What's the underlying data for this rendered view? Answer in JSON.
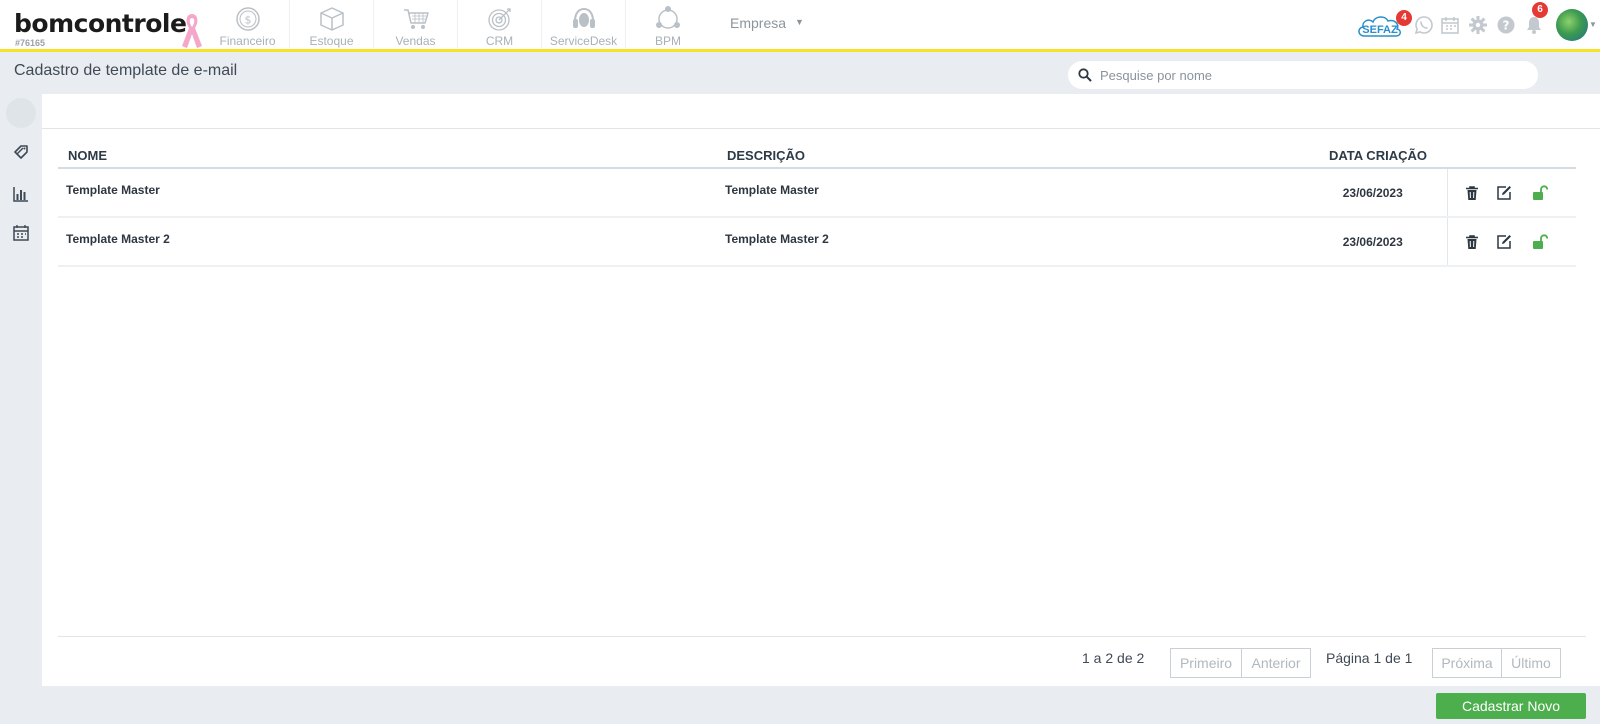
{
  "header": {
    "logo_text": "bomcontrole",
    "account_id": "#76165",
    "modules": [
      {
        "label": "Financeiro",
        "icon": "dollar-coin-icon"
      },
      {
        "label": "Estoque",
        "icon": "box-icon"
      },
      {
        "label": "Vendas",
        "icon": "cart-icon"
      },
      {
        "label": "CRM",
        "icon": "target-icon"
      },
      {
        "label": "ServiceDesk",
        "icon": "headset-icon"
      },
      {
        "label": "BPM",
        "icon": "process-icon"
      }
    ],
    "company_label": "Empresa",
    "sefaz_label": "SEFAZ",
    "sefaz_badge": "4",
    "notifications_badge": "6"
  },
  "page": {
    "title": "Cadastro de template de e-mail",
    "search_placeholder": "Pesquise por nome"
  },
  "table": {
    "columns": [
      "NOME",
      "DESCRIÇÃO",
      "DATA CRIAÇÃO"
    ],
    "rows": [
      {
        "nome": "Template Master",
        "descricao": "Template Master",
        "data": "23/06/2023"
      },
      {
        "nome": "Template Master 2",
        "descricao": "Template Master 2",
        "data": "23/06/2023"
      }
    ]
  },
  "pagination": {
    "range": "1 a 2 de 2",
    "first": "Primeiro",
    "previous": "Anterior",
    "page_text": "Página 1 de 1",
    "next": "Próxima",
    "last": "Último"
  },
  "actions": {
    "new_button": "Cadastrar Novo"
  },
  "colors": {
    "accent_yellow": "#f7e227",
    "primary_green": "#4cae4c",
    "unlock_green": "#4cae4c",
    "badge_red": "#e53935"
  }
}
